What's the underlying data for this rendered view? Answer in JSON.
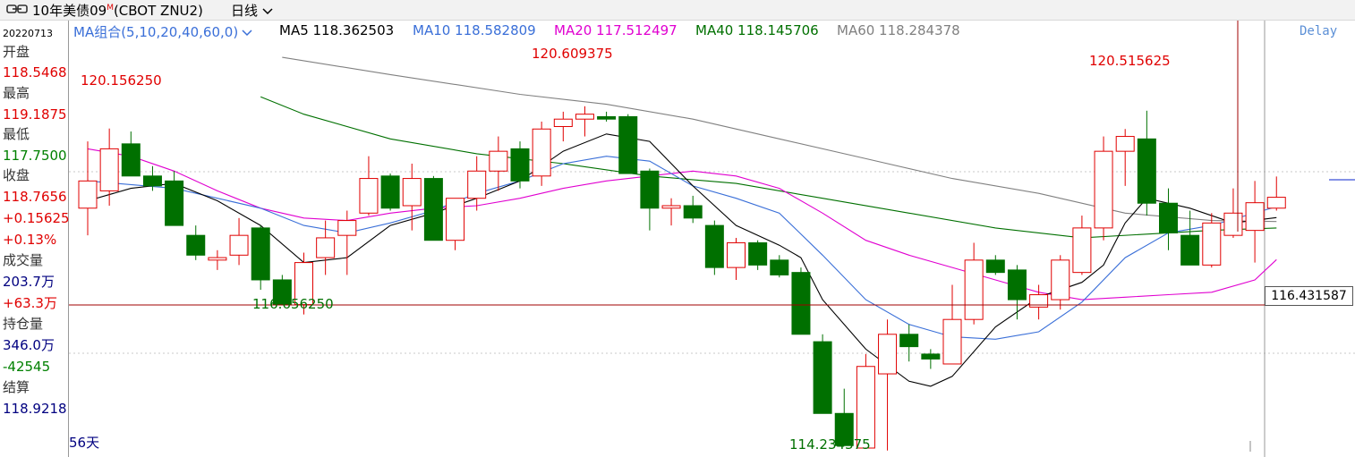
{
  "header": {
    "title": "10年美债09",
    "badge": "M",
    "symbol": "(CBOT ZNU2)",
    "period": "日线"
  },
  "side_panel": {
    "date": "20220713",
    "open_label": "开盘",
    "open_value": "118.5468",
    "high_label": "最高",
    "high_value": "119.1875",
    "low_label": "最低",
    "low_value": "117.7500",
    "close_label": "收盘",
    "close_value": "118.7656",
    "change": "+0.15625",
    "change_pct": "+0.13%",
    "volume_label": "成交量",
    "volume_value": "203.7万",
    "volume_change": "+63.3万",
    "oi_label": "持仓量",
    "oi_value": "346.0万",
    "oi_change": "-42545",
    "settle_label": "结算",
    "settle_value": "118.9218"
  },
  "ma_legend": {
    "group": "MA组合(5,10,20,40,60,0)",
    "ma5": "MA5 118.362503",
    "ma10": "MA10 118.582809",
    "ma20": "MA20 117.512497",
    "ma40": "MA40 118.145706",
    "ma60": "MA60 118.284378"
  },
  "status": {
    "delay": "Delay",
    "days": "56天"
  },
  "cursor_price": "116.431587",
  "colors": {
    "up": "#e00000",
    "down": "#007000",
    "ma5": "#000000",
    "ma10": "#3a6fd8",
    "ma20": "#e000d0",
    "ma40": "#007000",
    "ma60": "#808080",
    "crosshair": "#a00000"
  },
  "chart_data": {
    "type": "candlestick",
    "y_range": [
      113.7,
      121.8
    ],
    "highlights": [
      {
        "label": "120.156250",
        "value": 120.15625,
        "kind": "high"
      },
      {
        "label": "120.609375",
        "value": 120.609375,
        "kind": "high"
      },
      {
        "label": "120.515625",
        "value": 120.515625,
        "kind": "high"
      },
      {
        "label": "116.656250",
        "value": 116.65625,
        "kind": "low"
      },
      {
        "label": "114.234375",
        "value": 114.234375,
        "kind": "low"
      }
    ],
    "candles": [
      {
        "o": 118.55,
        "h": 119.9,
        "l": 118.0,
        "c": 119.1
      },
      {
        "o": 118.9,
        "h": 120.16,
        "l": 118.6,
        "c": 119.75
      },
      {
        "o": 119.85,
        "h": 120.1,
        "l": 119.2,
        "c": 119.2
      },
      {
        "o": 119.2,
        "h": 119.4,
        "l": 118.9,
        "c": 119.0
      },
      {
        "o": 119.1,
        "h": 119.3,
        "l": 118.2,
        "c": 118.2
      },
      {
        "o": 118.0,
        "h": 118.2,
        "l": 117.5,
        "c": 117.6
      },
      {
        "o": 117.5,
        "h": 117.7,
        "l": 117.3,
        "c": 117.55
      },
      {
        "o": 117.6,
        "h": 118.35,
        "l": 117.4,
        "c": 118.0
      },
      {
        "o": 118.15,
        "h": 118.2,
        "l": 116.9,
        "c": 117.1
      },
      {
        "o": 117.1,
        "h": 117.2,
        "l": 116.66,
        "c": 116.6
      },
      {
        "o": 116.6,
        "h": 117.65,
        "l": 116.4,
        "c": 117.45
      },
      {
        "o": 117.55,
        "h": 118.3,
        "l": 117.2,
        "c": 117.95
      },
      {
        "o": 118.0,
        "h": 118.5,
        "l": 117.2,
        "c": 118.3
      },
      {
        "o": 118.45,
        "h": 119.6,
        "l": 118.4,
        "c": 119.15
      },
      {
        "o": 119.2,
        "h": 119.25,
        "l": 118.5,
        "c": 118.55
      },
      {
        "o": 118.6,
        "h": 119.45,
        "l": 118.1,
        "c": 119.15
      },
      {
        "o": 119.15,
        "h": 119.2,
        "l": 117.9,
        "c": 117.9
      },
      {
        "o": 117.9,
        "h": 118.75,
        "l": 117.7,
        "c": 118.75
      },
      {
        "o": 118.75,
        "h": 119.6,
        "l": 118.5,
        "c": 119.3
      },
      {
        "o": 119.3,
        "h": 120.0,
        "l": 118.9,
        "c": 119.7
      },
      {
        "o": 119.75,
        "h": 119.9,
        "l": 118.95,
        "c": 119.1
      },
      {
        "o": 119.2,
        "h": 120.3,
        "l": 119.0,
        "c": 120.15
      },
      {
        "o": 120.2,
        "h": 120.5,
        "l": 119.9,
        "c": 120.35
      },
      {
        "o": 120.35,
        "h": 120.61,
        "l": 120.0,
        "c": 120.45
      },
      {
        "o": 120.4,
        "h": 120.5,
        "l": 120.3,
        "c": 120.35
      },
      {
        "o": 120.4,
        "h": 120.45,
        "l": 119.25,
        "c": 119.25
      },
      {
        "o": 119.3,
        "h": 119.35,
        "l": 118.1,
        "c": 118.55
      },
      {
        "o": 118.55,
        "h": 118.75,
        "l": 118.2,
        "c": 118.6
      },
      {
        "o": 118.6,
        "h": 118.8,
        "l": 118.25,
        "c": 118.35
      },
      {
        "o": 118.2,
        "h": 118.3,
        "l": 117.2,
        "c": 117.35
      },
      {
        "o": 117.35,
        "h": 117.95,
        "l": 117.1,
        "c": 117.85
      },
      {
        "o": 117.85,
        "h": 117.9,
        "l": 117.3,
        "c": 117.4
      },
      {
        "o": 117.5,
        "h": 117.6,
        "l": 117.15,
        "c": 117.2
      },
      {
        "o": 117.25,
        "h": 117.35,
        "l": 116.0,
        "c": 116.0
      },
      {
        "o": 115.85,
        "h": 116.0,
        "l": 114.4,
        "c": 114.4
      },
      {
        "o": 114.4,
        "h": 114.9,
        "l": 113.75,
        "c": 113.75
      },
      {
        "o": 113.7,
        "h": 115.6,
        "l": 113.7,
        "c": 115.35
      },
      {
        "o": 115.2,
        "h": 116.3,
        "l": 113.65,
        "c": 116.0
      },
      {
        "o": 116.0,
        "h": 116.2,
        "l": 115.45,
        "c": 115.75
      },
      {
        "o": 115.6,
        "h": 115.7,
        "l": 115.3,
        "c": 115.5
      },
      {
        "o": 115.4,
        "h": 117.0,
        "l": 115.4,
        "c": 116.3
      },
      {
        "o": 116.3,
        "h": 117.85,
        "l": 116.2,
        "c": 117.5
      },
      {
        "o": 117.5,
        "h": 117.6,
        "l": 117.2,
        "c": 117.25
      },
      {
        "o": 117.3,
        "h": 117.4,
        "l": 116.3,
        "c": 116.7
      },
      {
        "o": 116.55,
        "h": 117.0,
        "l": 116.3,
        "c": 116.8
      },
      {
        "o": 116.7,
        "h": 117.6,
        "l": 116.5,
        "c": 117.5
      },
      {
        "o": 117.25,
        "h": 118.4,
        "l": 117.2,
        "c": 118.15
      },
      {
        "o": 118.15,
        "h": 120.0,
        "l": 117.9,
        "c": 119.7
      },
      {
        "o": 119.7,
        "h": 120.15,
        "l": 119.0,
        "c": 120.0
      },
      {
        "o": 119.95,
        "h": 120.52,
        "l": 118.4,
        "c": 118.65
      },
      {
        "o": 118.65,
        "h": 118.95,
        "l": 117.7,
        "c": 118.05
      },
      {
        "o": 118.0,
        "h": 118.5,
        "l": 117.4,
        "c": 117.4
      },
      {
        "o": 117.4,
        "h": 118.45,
        "l": 117.35,
        "c": 118.25
      },
      {
        "o": 118.0,
        "h": 118.95,
        "l": 117.95,
        "c": 118.45
      },
      {
        "o": 118.1,
        "h": 119.1,
        "l": 117.45,
        "c": 118.66
      },
      {
        "o": 118.55,
        "h": 119.19,
        "l": 118.5,
        "c": 118.77
      }
    ],
    "ma5": [
      [
        0,
        118.7
      ],
      [
        2,
        118.95
      ],
      [
        4,
        119.05
      ],
      [
        6,
        118.7
      ],
      [
        8,
        118.2
      ],
      [
        10,
        117.45
      ],
      [
        12,
        117.55
      ],
      [
        14,
        118.2
      ],
      [
        16,
        118.45
      ],
      [
        18,
        118.75
      ],
      [
        20,
        119.1
      ],
      [
        22,
        119.7
      ],
      [
        24,
        120.05
      ],
      [
        26,
        119.9
      ],
      [
        28,
        119.0
      ],
      [
        30,
        118.2
      ],
      [
        32,
        117.8
      ],
      [
        33,
        117.55
      ],
      [
        34,
        116.7
      ],
      [
        36,
        115.7
      ],
      [
        38,
        115.05
      ],
      [
        39,
        114.95
      ],
      [
        40,
        115.15
      ],
      [
        42,
        116.15
      ],
      [
        44,
        116.75
      ],
      [
        46,
        117.05
      ],
      [
        47,
        117.4
      ],
      [
        48,
        118.25
      ],
      [
        49,
        118.75
      ],
      [
        51,
        118.55
      ],
      [
        53,
        118.25
      ],
      [
        55,
        118.36
      ]
    ],
    "ma10": [
      [
        0,
        119.1
      ],
      [
        4,
        118.95
      ],
      [
        8,
        118.55
      ],
      [
        10,
        118.2
      ],
      [
        12,
        118.05
      ],
      [
        14,
        118.25
      ],
      [
        16,
        118.5
      ],
      [
        18,
        118.85
      ],
      [
        20,
        119.1
      ],
      [
        22,
        119.45
      ],
      [
        24,
        119.6
      ],
      [
        26,
        119.5
      ],
      [
        28,
        119.0
      ],
      [
        30,
        118.75
      ],
      [
        32,
        118.45
      ],
      [
        34,
        117.6
      ],
      [
        36,
        116.7
      ],
      [
        38,
        116.2
      ],
      [
        40,
        115.95
      ],
      [
        42,
        115.9
      ],
      [
        44,
        116.05
      ],
      [
        46,
        116.65
      ],
      [
        48,
        117.55
      ],
      [
        50,
        118.05
      ],
      [
        52,
        118.2
      ],
      [
        55,
        118.58
      ]
    ],
    "ma20": [
      [
        0,
        119.75
      ],
      [
        2,
        119.6
      ],
      [
        4,
        119.3
      ],
      [
        6,
        118.9
      ],
      [
        8,
        118.55
      ],
      [
        10,
        118.35
      ],
      [
        12,
        118.3
      ],
      [
        14,
        118.45
      ],
      [
        16,
        118.55
      ],
      [
        18,
        118.6
      ],
      [
        20,
        118.75
      ],
      [
        22,
        118.95
      ],
      [
        24,
        119.1
      ],
      [
        26,
        119.2
      ],
      [
        28,
        119.3
      ],
      [
        30,
        119.2
      ],
      [
        32,
        118.95
      ],
      [
        34,
        118.45
      ],
      [
        36,
        117.9
      ],
      [
        38,
        117.6
      ],
      [
        40,
        117.35
      ],
      [
        42,
        117.1
      ],
      [
        44,
        116.85
      ],
      [
        46,
        116.7
      ],
      [
        48,
        116.75
      ],
      [
        50,
        116.8
      ],
      [
        52,
        116.85
      ],
      [
        54,
        117.1
      ],
      [
        55,
        117.51
      ]
    ],
    "ma40": [
      [
        8,
        120.8
      ],
      [
        10,
        120.45
      ],
      [
        14,
        119.95
      ],
      [
        18,
        119.65
      ],
      [
        22,
        119.45
      ],
      [
        26,
        119.2
      ],
      [
        30,
        119.05
      ],
      [
        34,
        118.75
      ],
      [
        38,
        118.45
      ],
      [
        42,
        118.15
      ],
      [
        46,
        117.95
      ],
      [
        50,
        118.05
      ],
      [
        52,
        118.1
      ],
      [
        55,
        118.15
      ]
    ],
    "ma60": [
      [
        9,
        121.6
      ],
      [
        14,
        121.25
      ],
      [
        20,
        120.85
      ],
      [
        24,
        120.65
      ],
      [
        28,
        120.35
      ],
      [
        32,
        119.95
      ],
      [
        36,
        119.55
      ],
      [
        40,
        119.15
      ],
      [
        44,
        118.85
      ],
      [
        48,
        118.45
      ],
      [
        52,
        118.3
      ],
      [
        55,
        118.28
      ]
    ]
  }
}
